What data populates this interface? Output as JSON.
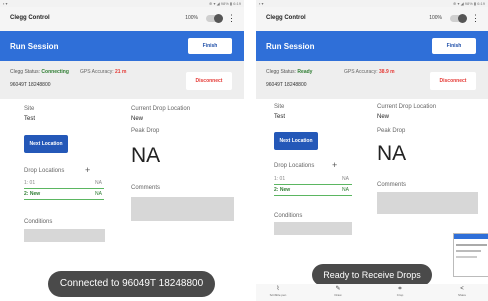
{
  "colors": {
    "primary": "#2f6fd8",
    "green": "#2e7d32",
    "red": "#e53935",
    "toast": "#4a4a4a"
  },
  "left": {
    "status_bar": {
      "left": "▪ ▾",
      "right": "⊕ ▾ ◢ 98% ▮ 6:19"
    },
    "app_title": "Clegg Control",
    "switch_label": "100%",
    "menu_icon": "more-vert-icon",
    "session_title": "Run Session",
    "finish_label": "Finish",
    "clegg_status_label": "Clegg Status:",
    "clegg_status_value": "Connecting",
    "gps_label": "GPS Accuracy:",
    "gps_value": "21 m",
    "device_id": "96049T 18248800",
    "disconnect_label": "Disconnect",
    "site_label": "Site",
    "site_value": "Test",
    "current_drop_label": "Current Drop Location",
    "current_drop_value": "New",
    "next_location_label": "Next Location",
    "peak_drop_label": "Peak Drop",
    "peak_drop_value": "NA",
    "drop_locations_label": "Drop Locations",
    "drop_rows": [
      {
        "name": "1: 01",
        "value": "NA"
      },
      {
        "name": "2: New",
        "value": "NA"
      }
    ],
    "comments_label": "Comments",
    "conditions_label": "Conditions",
    "toast": "Connected to 96049T 18248800"
  },
  "right": {
    "status_bar": {
      "left": "▪ ▾",
      "right": "⊕ ▾ ◢ 98% ▮ 6:19"
    },
    "app_title": "Clegg Control",
    "switch_label": "100%",
    "menu_icon": "more-vert-icon",
    "session_title": "Run Session",
    "finish_label": "Finish",
    "clegg_status_label": "Clegg Status:",
    "clegg_status_value": "Ready",
    "gps_label": "GPS Accuracy:",
    "gps_value": "38.9 m",
    "device_id": "96049T 18248800",
    "disconnect_label": "Disconnect",
    "site_label": "Site",
    "site_value": "Test",
    "current_drop_label": "Current Drop Location",
    "current_drop_value": "New",
    "next_location_label": "Next Location",
    "peak_drop_label": "Peak Drop",
    "peak_drop_value": "NA",
    "drop_locations_label": "Drop Locations",
    "drop_rows": [
      {
        "name": "1: 01",
        "value": "NA"
      },
      {
        "name": "2: New",
        "value": "NA"
      }
    ],
    "comments_label": "Comments",
    "conditions_label": "Conditions",
    "toast": "Ready to Receive Drops",
    "bottom_nav": [
      {
        "icon": "scribble-icon",
        "label": "Scribble pen"
      },
      {
        "icon": "pen-icon",
        "label": "Draw"
      },
      {
        "icon": "crop-icon",
        "label": "Crop"
      },
      {
        "icon": "share-icon",
        "label": "Share"
      }
    ]
  }
}
